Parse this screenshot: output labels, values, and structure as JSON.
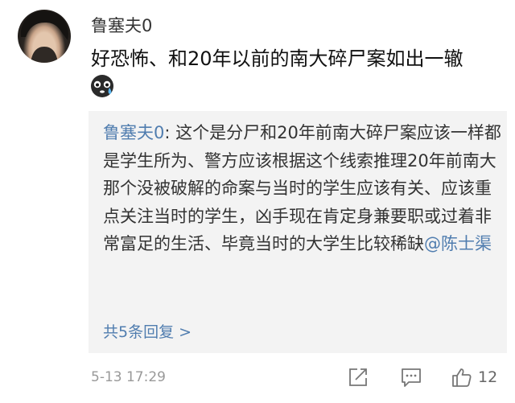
{
  "comment": {
    "username": "鲁塞夫0",
    "text": "好恐怖、和20年以前的南大碎尸案如出一辙",
    "emoji": "sweat-cry-emoji"
  },
  "reply": {
    "author": "鲁塞夫0",
    "separator": ":",
    "text": " 这个是分尸和20年前南大碎尸案应该一样都是学生所为、警方应该根据这个线索推理20年前南大那个没被破解的命案与当时的学生应该有关、应该重点关注当时的学生，凶手现在肯定身兼要职或过着非常富足的生活、毕竟当时的大学生比较稀缺",
    "mention": "@陈士渠",
    "more_replies": "共5条回复 >"
  },
  "footer": {
    "timestamp": "5-13 17:29",
    "like_count": "12"
  },
  "colors": {
    "link": "#507daf",
    "reply_bg": "#f3f3f3"
  }
}
